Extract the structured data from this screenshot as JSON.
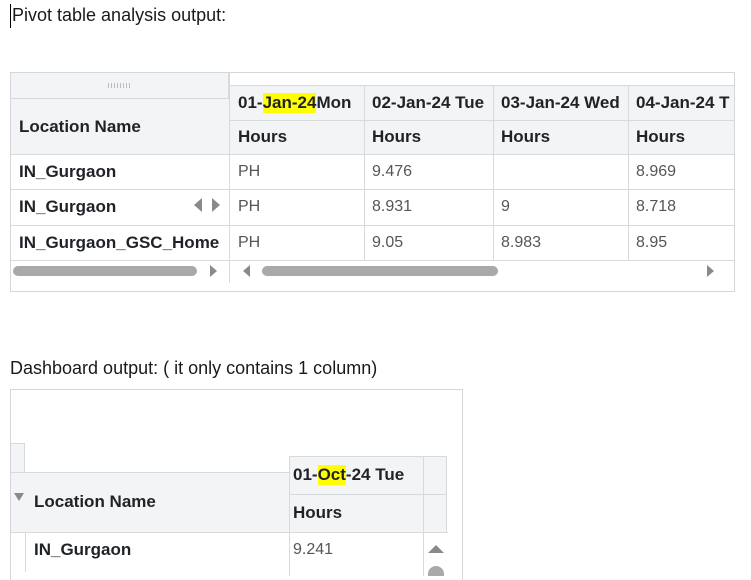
{
  "captions": {
    "pivot": "Pivot table analysis output:",
    "dashboard": "Dashboard output: ( it only contains 1 column)"
  },
  "pivot": {
    "row_header": "Location Name",
    "columns": [
      {
        "date_pre": "01-",
        "date_hl": "Jan-24",
        "date_post": " Mon",
        "sub": "Hours"
      },
      {
        "date": "02-Jan-24 Tue",
        "sub": "Hours"
      },
      {
        "date": "03-Jan-24 Wed",
        "sub": "Hours"
      },
      {
        "date": "04-Jan-24 T",
        "sub": "Hours"
      }
    ],
    "rows": [
      {
        "location": "IN_Gurgaon",
        "values": [
          "PH",
          "9.476",
          "",
          "8.969"
        ]
      },
      {
        "location": "IN_Gurgaon",
        "values": [
          "PH",
          "8.931",
          "9",
          "8.718"
        ]
      },
      {
        "location": "IN_Gurgaon_GSC_Home",
        "values": [
          "PH",
          "9.05",
          "8.983",
          "8.95"
        ]
      }
    ]
  },
  "dashboard": {
    "row_header": "Location Name",
    "column": {
      "date_pre": "01-",
      "date_hl": "Oct",
      "date_post": "-24 Tue",
      "sub": "Hours"
    },
    "rows": [
      {
        "location": "IN_Gurgaon",
        "value": "9.241"
      }
    ]
  },
  "colors": {
    "highlight": "#ffff00",
    "header_bg": "#f2f4f5",
    "grid": "#d6dadd"
  }
}
